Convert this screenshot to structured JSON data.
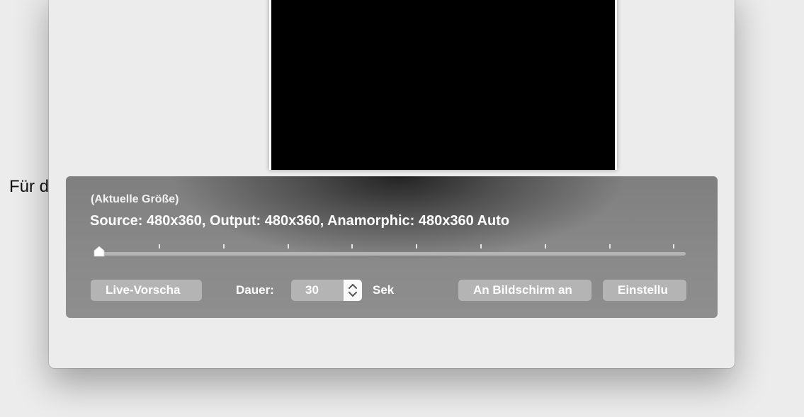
{
  "background": {
    "label_fragment": "Für d"
  },
  "hud": {
    "subtitle": "(Aktuelle Größe)",
    "title": "Source: 480x360, Output: 480x360, Anamorphic: 480x360 Auto",
    "slider": {
      "ticks": 10,
      "position": 0
    },
    "live_preview_label": "Live-Vorscha",
    "duration_label": "Dauer:",
    "duration_value": "30",
    "duration_unit": "Sek",
    "fit_screen_label": "An Bildschirm an",
    "settings_label": "Einstellu"
  },
  "icons": {
    "slider_knob": "slider-knob-icon",
    "stepper": "stepper-arrows-icon"
  },
  "colors": {
    "hud_bg": "#8a8a8a",
    "button_bg": "#b4b4b4",
    "video_bg": "#000000"
  }
}
